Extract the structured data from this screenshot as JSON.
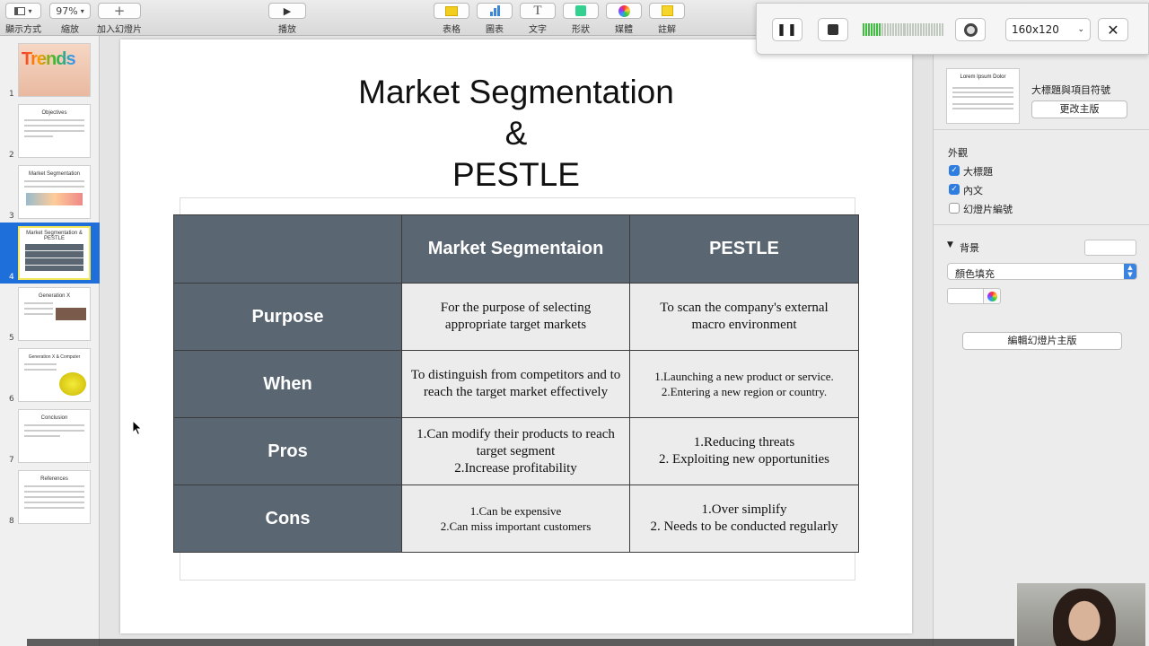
{
  "toolbar": {
    "view_label": "顯示方式",
    "zoom_value": "97%",
    "zoom_label": "縮放",
    "add_slide_label": "加入幻燈片",
    "play_label": "播放",
    "table_label": "表格",
    "chart_label": "圖表",
    "text_label": "文字",
    "shape_label": "形狀",
    "media_label": "媒體",
    "comment_label": "註解"
  },
  "slides": [
    {
      "number": "1",
      "title": "Trends"
    },
    {
      "number": "2",
      "title": "Objectives"
    },
    {
      "number": "3",
      "title": "Market Segmentation"
    },
    {
      "number": "4",
      "title": "Market Segmentation & PESTLE"
    },
    {
      "number": "5",
      "title": "Generation X"
    },
    {
      "number": "6",
      "title": "Generation X & Computer"
    },
    {
      "number": "7",
      "title": "Conclusion"
    },
    {
      "number": "8",
      "title": "References"
    }
  ],
  "selected_slide": 4,
  "slide": {
    "title_line1": "Market Segmentation",
    "title_line2": "&",
    "title_line3": "PESTLE",
    "table": {
      "header_market": "Market Segmentaion",
      "header_pestle": "PESTLE",
      "rows": [
        {
          "label": "Purpose",
          "market": "For the purpose of selecting\nappropriate target markets",
          "pestle": "To scan the company's external\nmacro environment"
        },
        {
          "label": "When",
          "market": "To distinguish from competitors and to\nreach the target market effectively",
          "pestle": "1.Launching a new product or service.\n2.Entering a new region or country."
        },
        {
          "label": "Pros",
          "market": "1.Can modify their products to reach\ntarget segment\n2.Increase profitability",
          "pestle": "1.Reducing threats\n2. Exploiting new opportunities"
        },
        {
          "label": "Cons",
          "market": "1.Can be expensive\n2.Can miss important customers",
          "pestle": "1.Over simplify\n2. Needs to be conducted regularly"
        }
      ]
    }
  },
  "right_panel": {
    "layout_thumb_title": "Lorem Ipsum Dolor",
    "layout_name": "大標題與項目符號",
    "change_master_label": "更改主版",
    "appearance_label": "外觀",
    "title_check_label": "大標題",
    "body_check_label": "內文",
    "slide_number_check_label": "幻燈片編號",
    "background_label": "背景",
    "fill_select_value": "顏色填充",
    "edit_master_label": "編輯幻燈片主版"
  },
  "recorder": {
    "resolution_value": "160x120"
  }
}
